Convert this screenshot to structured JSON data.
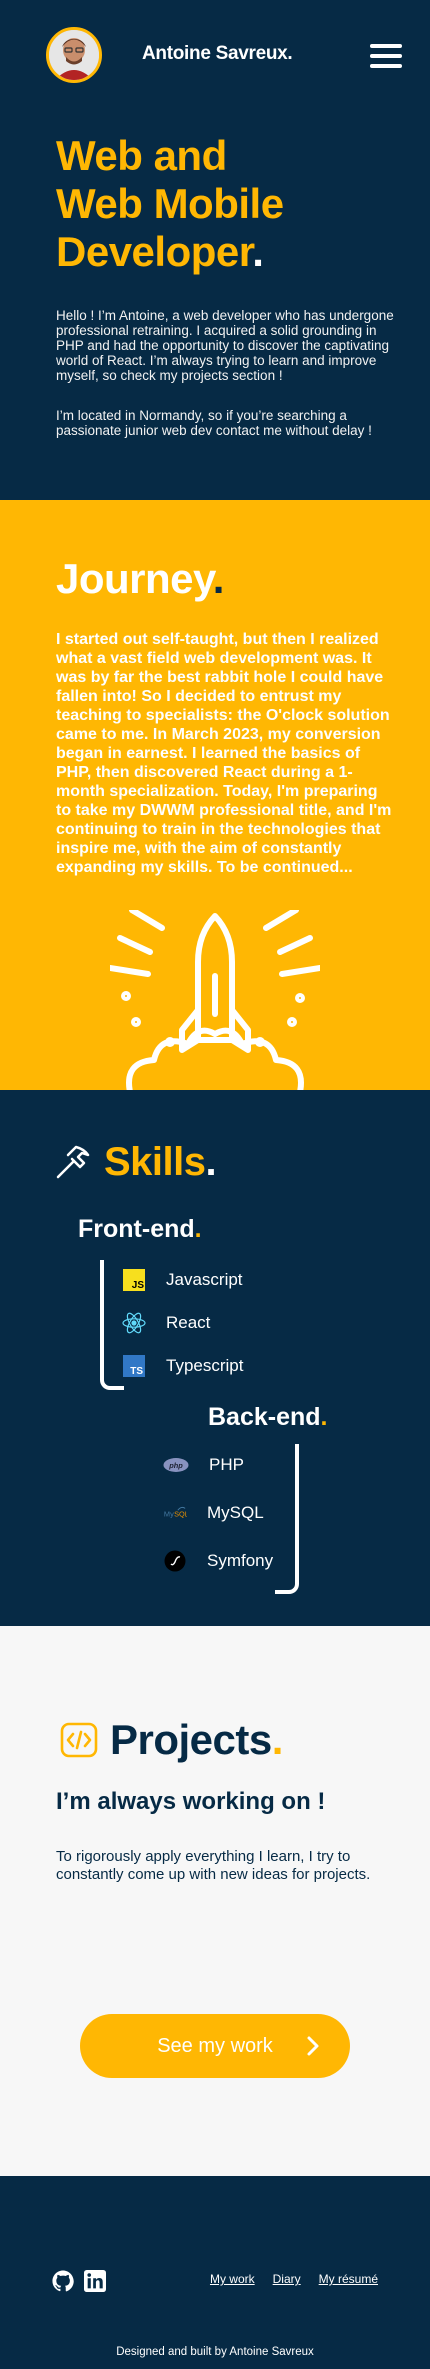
{
  "header": {
    "brand": "Antoine Savreux.",
    "avatar_alt": "profile photo"
  },
  "hero": {
    "title_line1": "Web and",
    "title_line2": "Web Mobile",
    "title_line3": "Developer",
    "title_dot": ".",
    "paragraph1": "Hello ! I’m Antoine, a web developer who has undergone professional retraining. I acquired a solid grounding in PHP and had the opportunity to discover the captivating world of React. I’m always trying to learn and improve myself, so check my projects section !",
    "paragraph2": "I’m located in Normandy, so if you’re searching a passionate junior web dev contact me without delay !"
  },
  "journey": {
    "title": "Journey",
    "dot": ".",
    "paragraph": "I started out self-taught, but then I realized what a vast field web development was. It was by far the best rabbit hole I could have fallen into! So I decided to entrust my teaching to specialists: the O'clock solution came to me. In March 2023, my conversion began in earnest. I learned the basics of PHP, then discovered React during a 1-month specialization. Today, I'm preparing to take my DWWM professional title, and I'm continuing to train in the technologies that inspire me, with the aim of constantly expanding my skills. To be continued..."
  },
  "skills": {
    "title": "Skills",
    "dot": ".",
    "front": {
      "title": "Front-end",
      "dot": ".",
      "items": [
        "Javascript",
        "React",
        "Typescript"
      ]
    },
    "back": {
      "title": "Back-end",
      "dot": ".",
      "items": [
        "PHP",
        "MySQL",
        "Symfony"
      ]
    }
  },
  "projects": {
    "title": "Projects",
    "dot": ".",
    "subtitle": "I’m always working on !",
    "paragraph": "To rigorously apply everything I learn, I try to constantly come up with new ideas for projects.",
    "cta": "See my work"
  },
  "footer": {
    "links": [
      "My work",
      "Diary",
      "My résumé"
    ],
    "credit": "Designed and built by Antoine Savreux"
  },
  "colors": {
    "navy": "#062a45",
    "accent": "#ffb703",
    "light": "#f7f7f7"
  },
  "icons": {
    "menu": "hamburger-icon",
    "skills": "hammer-icon",
    "projects": "code-icon",
    "cta": "chevron-right-icon",
    "social": [
      "github-icon",
      "linkedin-icon"
    ]
  }
}
